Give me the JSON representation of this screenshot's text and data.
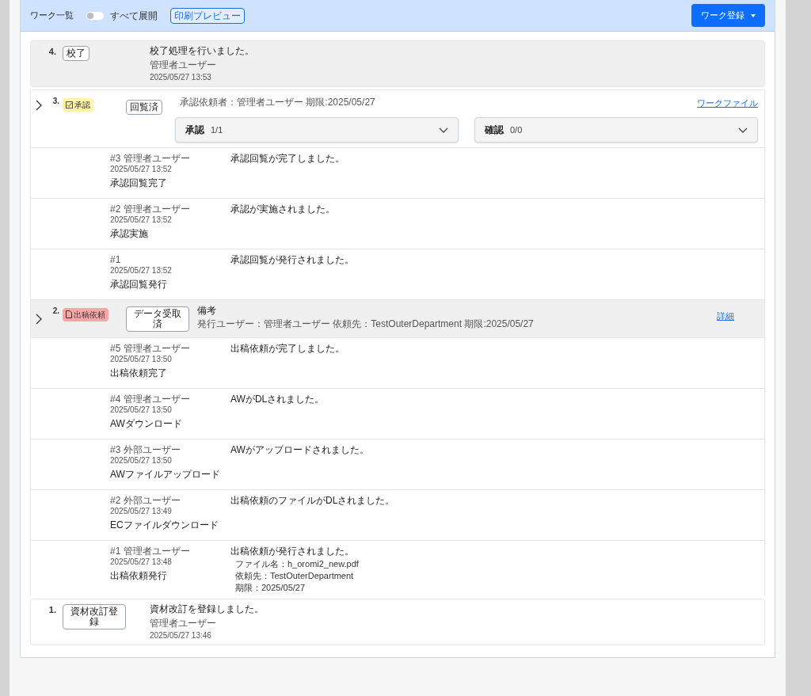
{
  "header": {
    "title": "ワーク一覧",
    "expand_all": {
      "label": "すべて展開",
      "on": false
    },
    "print_button": "印刷プレビュー",
    "register_button": "ワーク登録"
  },
  "entries": [
    {
      "kind": "event",
      "number": "4.",
      "status_button": "校了",
      "message": "校了処理を行いました。",
      "user": "管理者ユーザー",
      "datetime": "2025/05/27 13:53"
    },
    {
      "kind": "approval",
      "number": "3.",
      "tag": {
        "label": "承認",
        "color": "#fff3a8"
      },
      "status_button": "回覧済",
      "info": "承認依頼者：管理者ユーザー 期限:2025/05/27",
      "link": "ワークファイル",
      "accordions": [
        {
          "label": "承認",
          "count": "1/1"
        },
        {
          "label": "確認",
          "count": "0/0"
        }
      ],
      "history": [
        {
          "ref": "#3 管理者ユーザー",
          "datetime": "2025/05/27 13:52",
          "action": "承認回覧完了",
          "message": "承認回覧が完了しました。"
        },
        {
          "ref": "#2 管理者ユーザー",
          "datetime": "2025/05/27 13:52",
          "action": "承認実施",
          "message": "承認が実施されました。"
        },
        {
          "ref": "#1",
          "datetime": "2025/05/27 13:52",
          "action": "承認回覧発行",
          "message": "承認回覧が発行されました。"
        }
      ]
    },
    {
      "kind": "request",
      "number": "2.",
      "tag": {
        "label": "出稿依頼",
        "color": "#f8a5a5"
      },
      "status_button": "データ受取済",
      "title": "備考",
      "info": "発行ユーザー：管理者ユーザー 依頼先：TestOuterDepartment 期限:2025/05/27",
      "link": "詳細",
      "history": [
        {
          "ref": "#5 管理者ユーザー",
          "datetime": "2025/05/27 13:50",
          "action": "出稿依頼完了",
          "message": "出稿依頼が完了しました。"
        },
        {
          "ref": "#4 管理者ユーザー",
          "datetime": "2025/05/27 13:50",
          "action": "AWダウンロード",
          "message": "AWがDLされました。"
        },
        {
          "ref": "#3 外部ユーザー",
          "datetime": "2025/05/27 13:50",
          "action": "AWファイルアップロード",
          "message": "AWがアップロードされました。"
        },
        {
          "ref": "#2 外部ユーザー",
          "datetime": "2025/05/27 13:49",
          "action": "ECファイルダウンロード",
          "message": "出稿依頼のファイルがDLされました。"
        },
        {
          "ref": "#1 管理者ユーザー",
          "datetime": "2025/05/27 13:48",
          "action": "出稿依頼発行",
          "message": "出稿依頼が発行されました。",
          "details": [
            "ファイル名：h_oromi2_new.pdf",
            "依頼先：TestOuterDepartment",
            "期限：2025/05/27"
          ]
        }
      ]
    },
    {
      "kind": "registration",
      "number": "1.",
      "status_button": "資材改訂登録",
      "message": "資材改訂を登録しました。",
      "user": "管理者ユーザー",
      "datetime": "2025/05/27 13:46"
    }
  ]
}
